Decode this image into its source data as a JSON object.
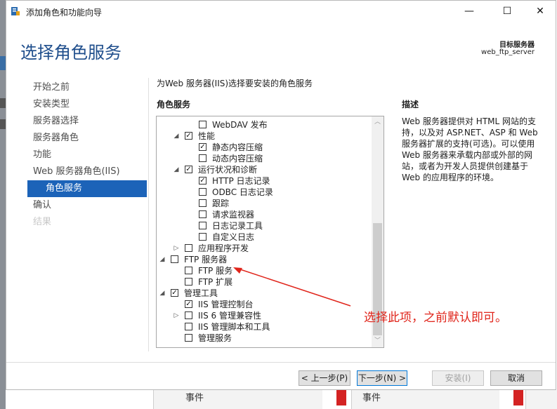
{
  "window": {
    "title": "添加角色和功能向导",
    "controls": {
      "minimize": "—",
      "maximize": "☐",
      "close": "✕"
    }
  },
  "header": {
    "title": "选择角色服务",
    "target_label": "目标服务器",
    "target_server": "web_ftp_server"
  },
  "nav": {
    "items": [
      {
        "label": "开始之前",
        "state": "normal"
      },
      {
        "label": "安装类型",
        "state": "normal"
      },
      {
        "label": "服务器选择",
        "state": "normal"
      },
      {
        "label": "服务器角色",
        "state": "normal"
      },
      {
        "label": "功能",
        "state": "normal"
      },
      {
        "label": "Web 服务器角色(IIS)",
        "state": "normal"
      },
      {
        "label": "角色服务",
        "state": "active"
      },
      {
        "label": "确认",
        "state": "normal"
      },
      {
        "label": "结果",
        "state": "disabled"
      }
    ]
  },
  "main": {
    "instruction": "为Web 服务器(IIS)选择要安装的角色服务",
    "roles_heading": "角色服务",
    "tree": [
      {
        "label": "WebDAV 发布",
        "checked": false,
        "expander": ""
      },
      {
        "label": "性能",
        "checked": true,
        "expander": "◢"
      },
      {
        "label": "静态内容压缩",
        "checked": true,
        "expander": ""
      },
      {
        "label": "动态内容压缩",
        "checked": false,
        "expander": ""
      },
      {
        "label": "运行状况和诊断",
        "checked": true,
        "expander": "◢"
      },
      {
        "label": "HTTP 日志记录",
        "checked": true,
        "expander": ""
      },
      {
        "label": "ODBC 日志记录",
        "checked": false,
        "expander": ""
      },
      {
        "label": "跟踪",
        "checked": false,
        "expander": ""
      },
      {
        "label": "请求监视器",
        "checked": false,
        "expander": ""
      },
      {
        "label": "日志记录工具",
        "checked": false,
        "expander": ""
      },
      {
        "label": "自定义日志",
        "checked": false,
        "expander": ""
      },
      {
        "label": "应用程序开发",
        "checked": false,
        "expander": "▷"
      },
      {
        "label": "FTP 服务器",
        "checked": false,
        "expander": "◢"
      },
      {
        "label": "FTP 服务",
        "checked": false,
        "expander": ""
      },
      {
        "label": "FTP 扩展",
        "checked": false,
        "expander": ""
      },
      {
        "label": "管理工具",
        "checked": true,
        "expander": "◢"
      },
      {
        "label": "IIS 管理控制台",
        "checked": true,
        "expander": ""
      },
      {
        "label": "IIS 6 管理兼容性",
        "checked": false,
        "expander": "▷"
      },
      {
        "label": "IIS 管理脚本和工具",
        "checked": false,
        "expander": ""
      },
      {
        "label": "管理服务",
        "checked": false,
        "expander": ""
      }
    ],
    "scroll": {
      "up": "︿",
      "down": "﹀"
    }
  },
  "description": {
    "heading": "描述",
    "text": "Web 服务器提供对 HTML 网站的支持，以及对 ASP.NET、ASP 和 Web 服务器扩展的支持(可选)。可以使用 Web 服务器来承载内部或外部的网站，或者为开发人员提供创建基于 Web 的应用程序的环境。"
  },
  "annotation": {
    "text": "选择此项，之前默认即可。",
    "color": "#e0251b"
  },
  "buttons": {
    "previous": "< 上一步(P)",
    "next": "下一步(N) >",
    "install": "安装(I)",
    "cancel": "取消"
  },
  "background": {
    "events_1": "事件",
    "events_2": "事件"
  },
  "colors": {
    "accent": "#1c63b8",
    "title": "#1f4e8c"
  }
}
